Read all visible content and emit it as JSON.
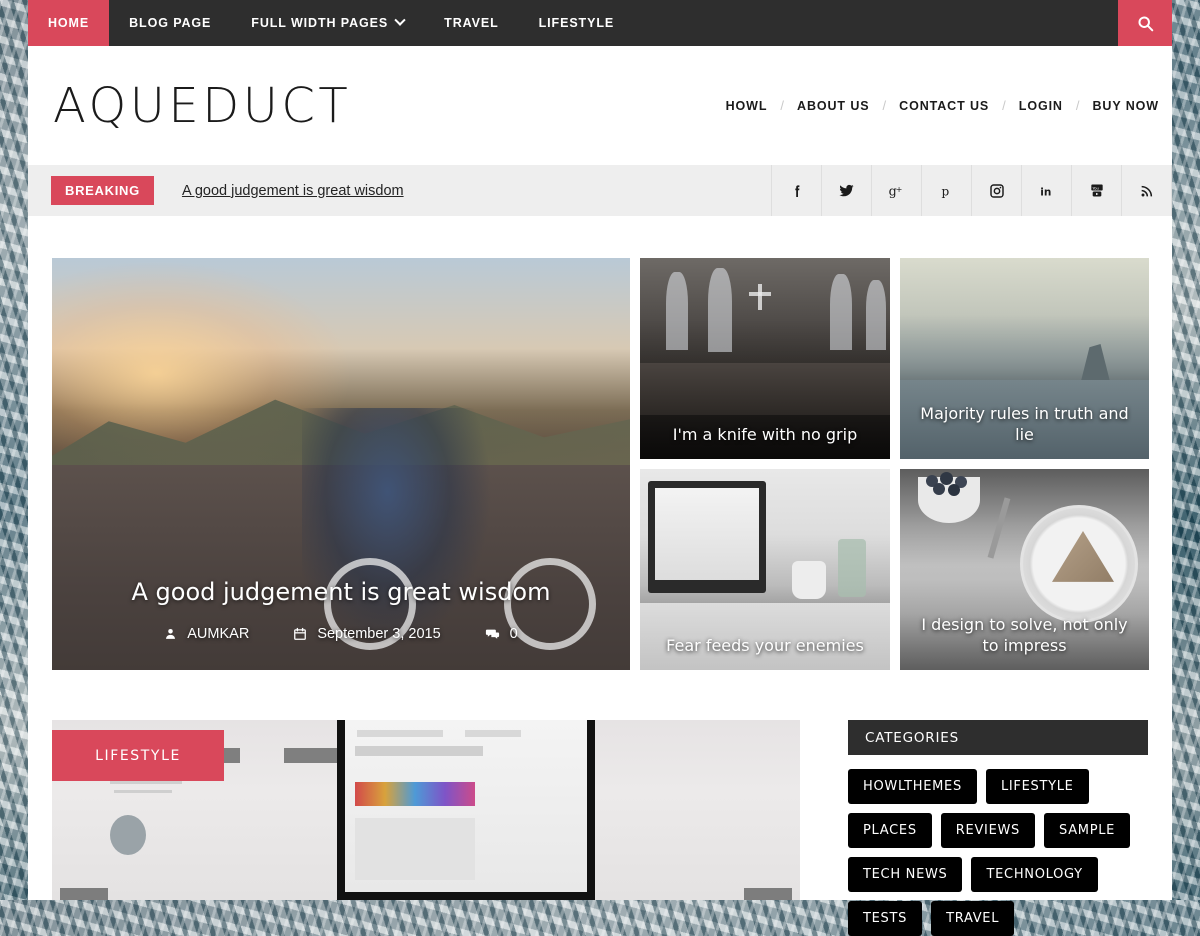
{
  "site": {
    "logo": "AQUEDUCT"
  },
  "navbar": {
    "items": [
      {
        "label": "HOME",
        "active": true,
        "dropdown": false
      },
      {
        "label": "BLOG PAGE",
        "active": false,
        "dropdown": false
      },
      {
        "label": "FULL WIDTH PAGES",
        "active": false,
        "dropdown": true
      },
      {
        "label": "TRAVEL",
        "active": false,
        "dropdown": false
      },
      {
        "label": "LIFESTYLE",
        "active": false,
        "dropdown": false
      }
    ],
    "search_icon": "search-icon"
  },
  "top_nav": {
    "items": [
      "HOWL",
      "ABOUT US",
      "CONTACT US",
      "LOGIN",
      "BUY NOW"
    ],
    "separator": "/"
  },
  "breaking": {
    "badge": "BREAKING",
    "headline": "A good judgement is great wisdom",
    "socials": [
      {
        "name": "facebook-icon",
        "glyph": "f"
      },
      {
        "name": "twitter-icon",
        "glyph": "t"
      },
      {
        "name": "google-plus-icon",
        "glyph": "g+"
      },
      {
        "name": "pinterest-icon",
        "glyph": "p"
      },
      {
        "name": "instagram-icon",
        "glyph": "ig"
      },
      {
        "name": "linkedin-icon",
        "glyph": "in"
      },
      {
        "name": "youtube-icon",
        "glyph": "yt"
      },
      {
        "name": "rss-icon",
        "glyph": "rss"
      }
    ]
  },
  "hero": {
    "title": "A good judgement is great wisdom",
    "author": "AUMKAR",
    "date": "September 3, 2015",
    "comments": "0",
    "author_icon": "user-icon",
    "date_icon": "calendar-icon",
    "comments_icon": "comment-icon"
  },
  "tiles": [
    {
      "caption": "I'm a knife with no grip"
    },
    {
      "caption": "Majority rules in truth and lie"
    },
    {
      "caption": "Fear feeds your enemies"
    },
    {
      "caption": "I design to solve, not only to impress"
    }
  ],
  "lower_post": {
    "category_badge": "LIFESTYLE"
  },
  "sidebar": {
    "categories_title": "CATEGORIES",
    "tags": [
      "HOWLTHEMES",
      "LIFESTYLE",
      "PLACES",
      "REVIEWS",
      "SAMPLE",
      "TECH NEWS",
      "TECHNOLOGY",
      "TESTS",
      "TRAVEL"
    ]
  },
  "colors": {
    "accent": "#d9485b",
    "dark": "#2e2e2e",
    "breaking_bg": "#eeeeee",
    "tag_bg": "#000000"
  }
}
